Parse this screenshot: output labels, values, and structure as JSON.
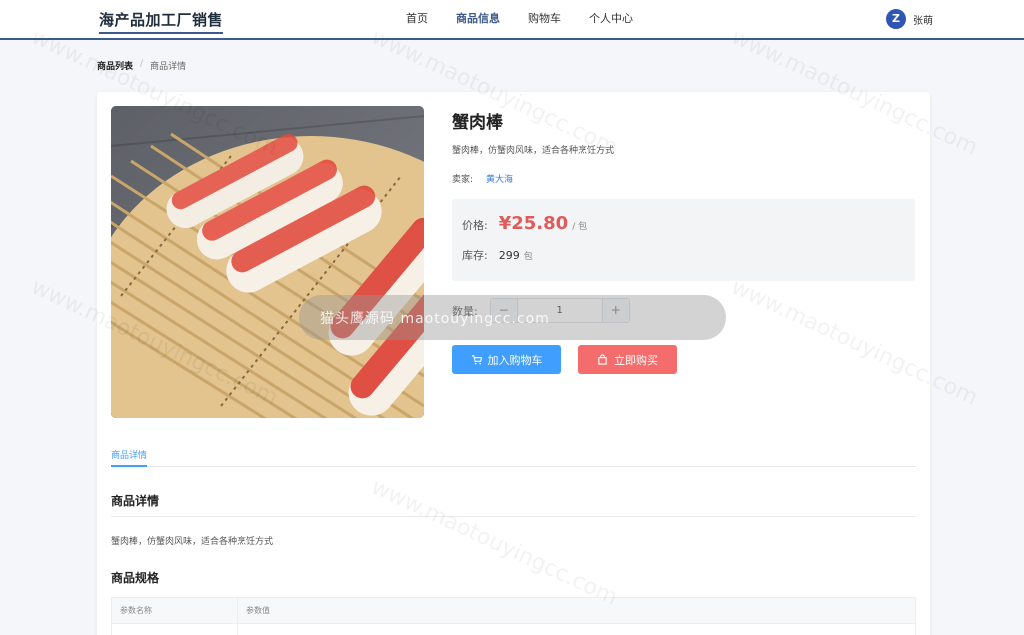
{
  "header": {
    "brand": "海产品加工厂销售",
    "nav": [
      "首页",
      "商品信息",
      "购物车",
      "个人中心"
    ],
    "active_nav": "商品信息",
    "user": {
      "avatar_letter": "Z",
      "name": "张萌"
    }
  },
  "breadcrumb": {
    "list": "商品列表",
    "sep": "/",
    "current": "商品详情"
  },
  "product": {
    "name": "蟹肉棒",
    "description": "蟹肉棒，仿蟹肉风味，适合各种烹饪方式",
    "seller_label": "卖家:",
    "seller_name": "黄大海",
    "price_label": "价格:",
    "price": "¥25.80",
    "price_unit": "/ 包",
    "stock_label": "库存:",
    "stock": "299",
    "stock_unit": "包",
    "quantity_label": "数量:",
    "quantity": "1",
    "minus": "−",
    "plus": "+",
    "add_to_cart": "加入购物车",
    "buy_now": "立即购买"
  },
  "tabs": [
    "商品详情"
  ],
  "detail": {
    "title": "商品详情",
    "text": "蟹肉棒，仿蟹肉风味，适合各种烹饪方式",
    "spec_title": "商品规格",
    "spec_headers": [
      "参数名称",
      "参数值"
    ]
  },
  "overlay": {
    "text": "猫头鹰源码 maotouyingcc.com"
  },
  "colors": {
    "primary": "#409eff",
    "danger": "#f56c6c",
    "price": "#e05a5a",
    "brand": "#3d5a8a"
  }
}
